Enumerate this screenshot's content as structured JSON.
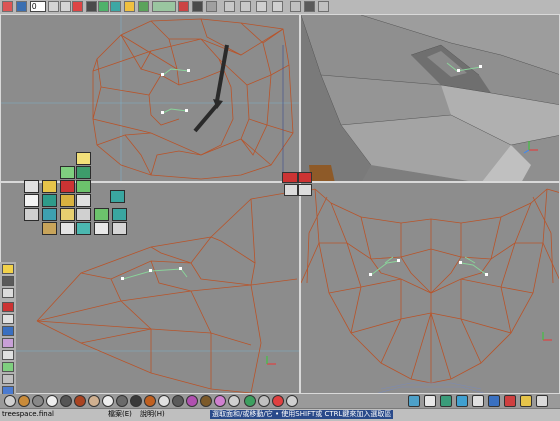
{
  "toolbar": {
    "frame_value": "0",
    "buttons": [
      "red-cross-icon",
      "rewind-icon",
      "step-back-icon",
      "step-forward-icon",
      "play-icon",
      "grid-icon",
      "chart-icon",
      "torus-icon",
      "cube-icon",
      "wire-icon"
    ]
  },
  "status_bar": {
    "window_title": "treespace.final",
    "menu_file": "檔案(E)",
    "menu_help": "說明(H)",
    "hint": "選取面和/或移動/它 • 使用SHIFT或 CTRL鍵來加入選取區"
  },
  "colors": {
    "viewport_bg": "#8a8a8a",
    "wire_color": "#b8542a",
    "highlight": "#8ad39a",
    "selection_white": "#ffffff",
    "viewport_divider": "#d9d9d9"
  },
  "viewports": [
    "top-left-orthographic",
    "top-right-perspective",
    "bottom-left-side",
    "bottom-right-front"
  ]
}
